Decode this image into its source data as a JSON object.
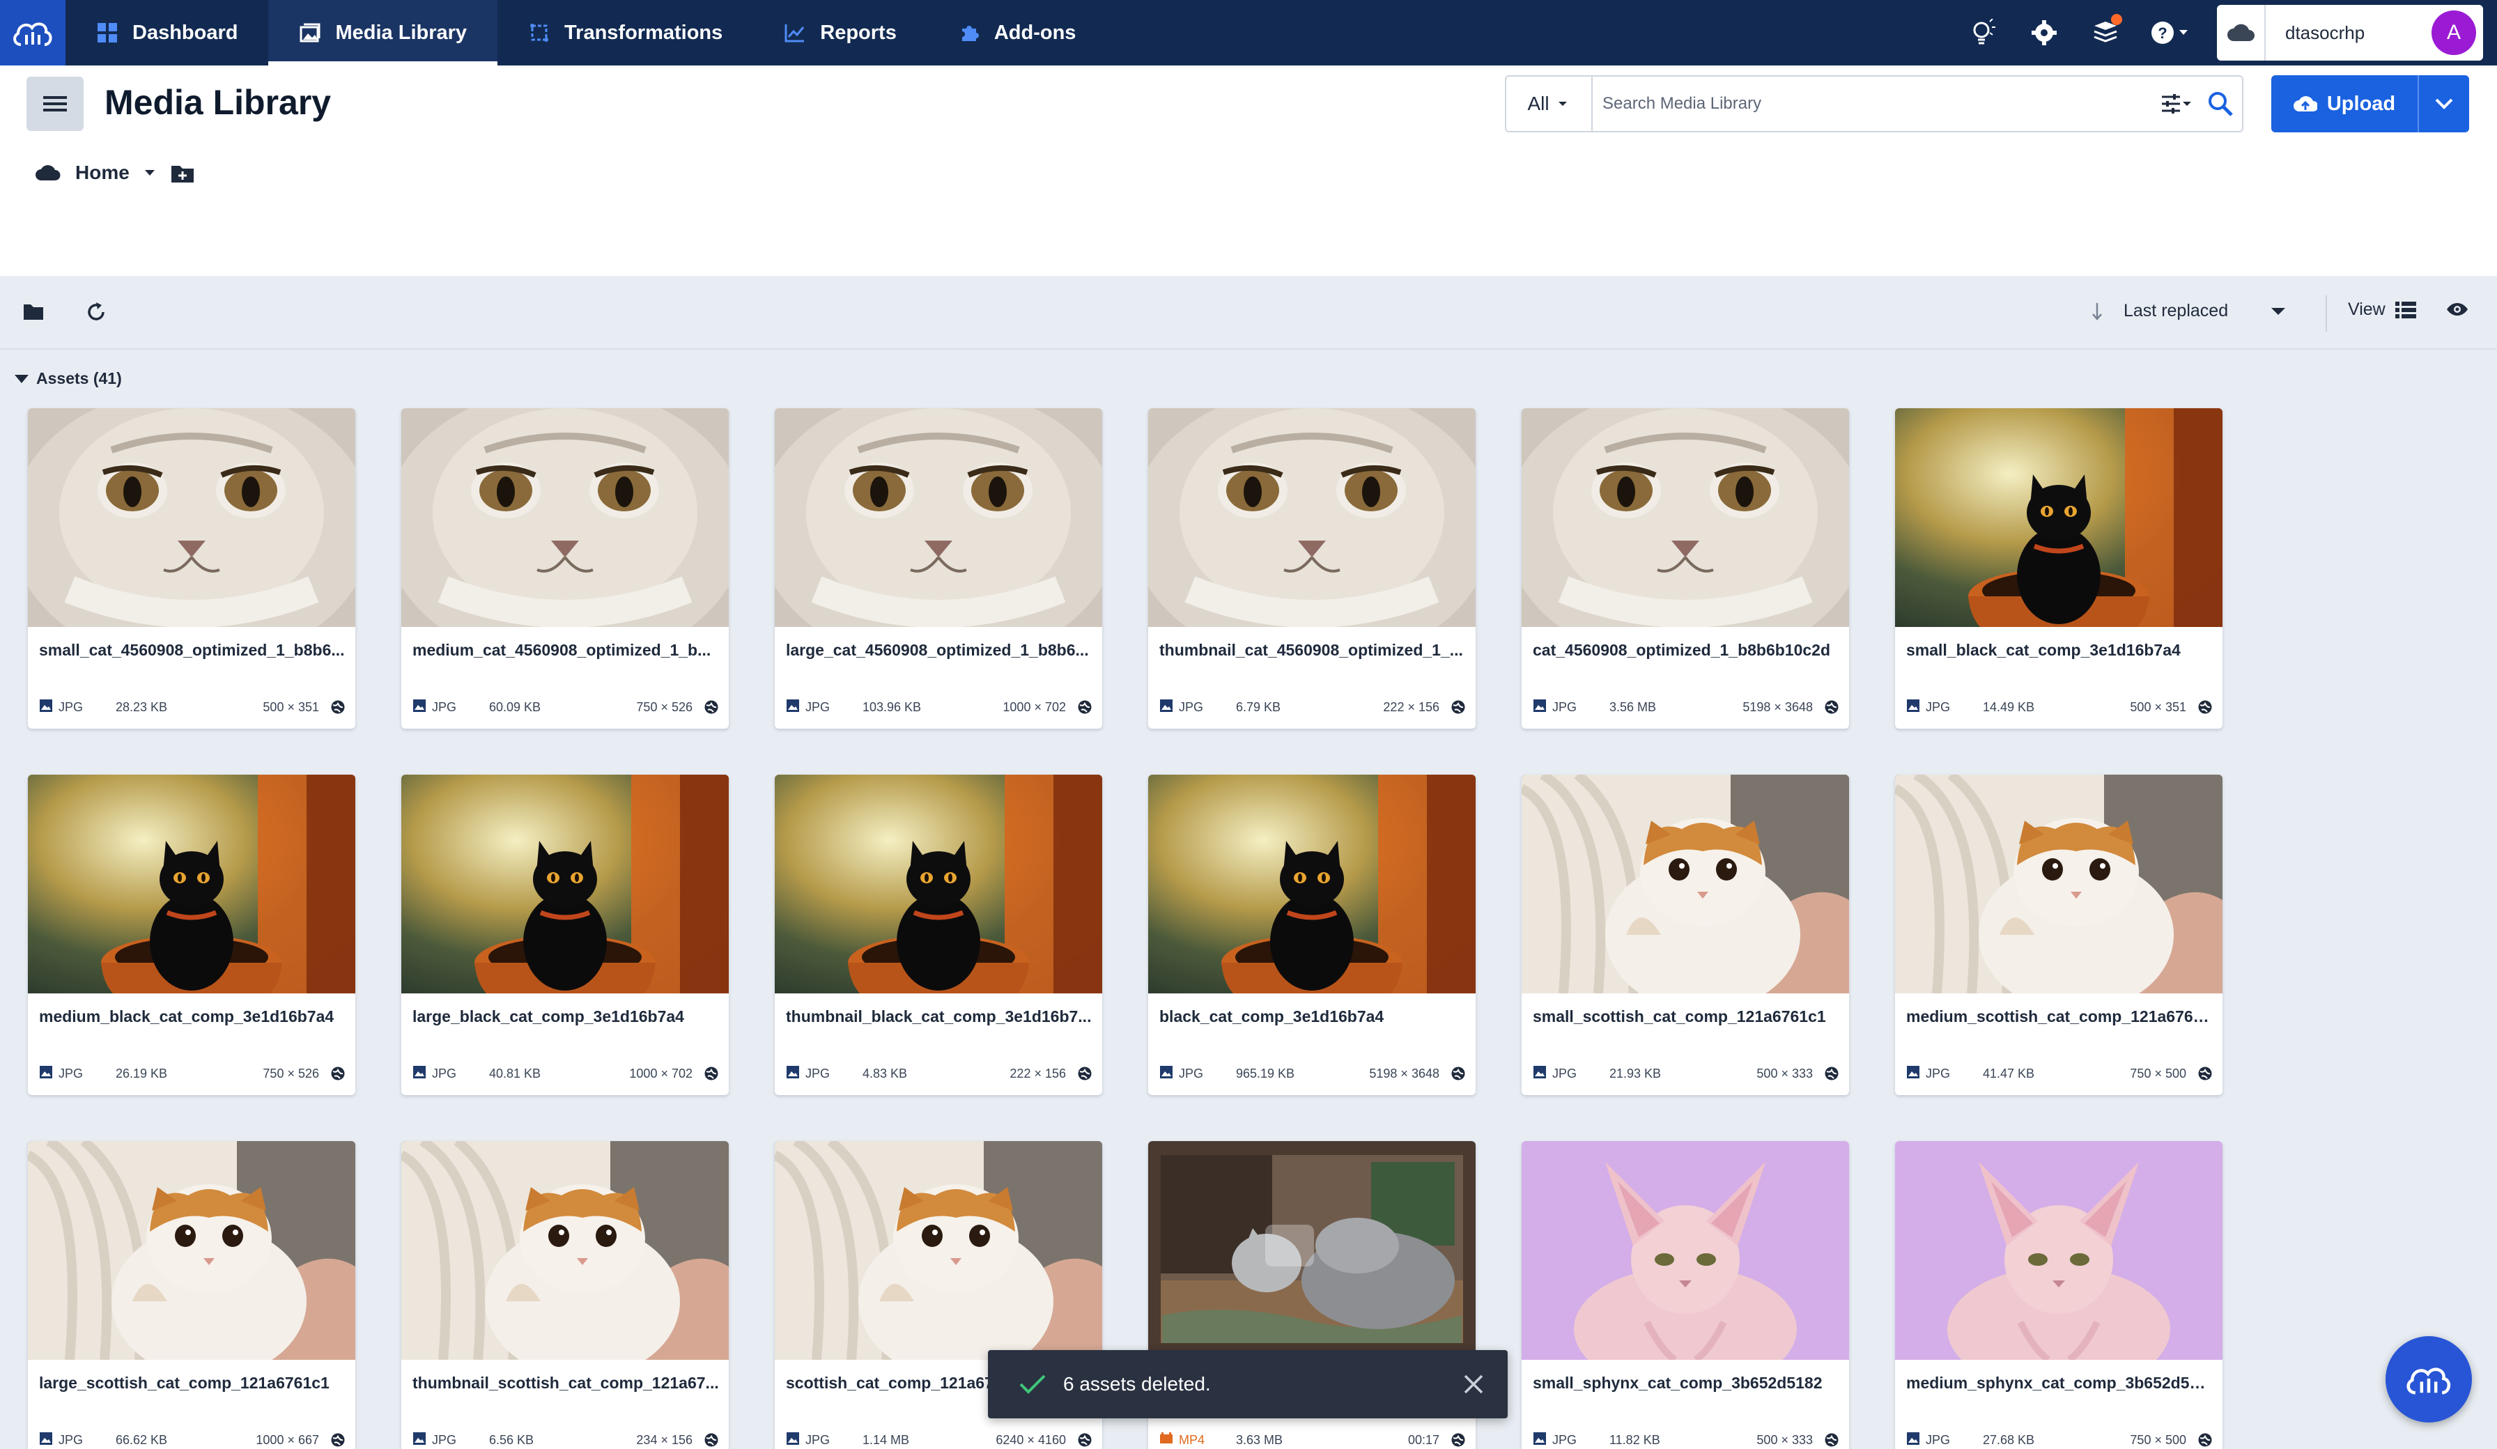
{
  "nav": {
    "items": [
      {
        "label": "Dashboard",
        "icon": "dashboard-icon"
      },
      {
        "label": "Media Library",
        "icon": "media-library-icon",
        "active": true
      },
      {
        "label": "Transformations",
        "icon": "transformations-icon"
      },
      {
        "label": "Reports",
        "icon": "reports-icon"
      },
      {
        "label": "Add-ons",
        "icon": "addons-icon"
      }
    ],
    "right_icons": [
      "lightbulb-icon",
      "gear-icon",
      "notifications-icon",
      "help-icon"
    ],
    "account_name": "dtasocrhp",
    "avatar_initial": "A",
    "colors": {
      "nav_bg": "#122a52",
      "avatar": "#9b1bd4",
      "accent": "#1a62e0"
    }
  },
  "header": {
    "title": "Media Library",
    "search_scope": "All",
    "search_placeholder": "Search Media Library",
    "upload_label": "Upload",
    "breadcrumb_home": "Home"
  },
  "toolbar": {
    "sort_label": "Last replaced",
    "view_label": "View"
  },
  "assets": {
    "heading": "Assets (41)",
    "items": [
      {
        "name": "small_cat_4560908_optimized_1_b8b6...",
        "type": "JPG",
        "size": "28.23 KB",
        "dims": "500 × 351",
        "image": "persian"
      },
      {
        "name": "medium_cat_4560908_optimized_1_b...",
        "type": "JPG",
        "size": "60.09 KB",
        "dims": "750 × 526",
        "image": "persian"
      },
      {
        "name": "large_cat_4560908_optimized_1_b8b6...",
        "type": "JPG",
        "size": "103.96 KB",
        "dims": "1000 × 702",
        "image": "persian"
      },
      {
        "name": "thumbnail_cat_4560908_optimized_1_...",
        "type": "JPG",
        "size": "6.79 KB",
        "dims": "222 × 156",
        "image": "persian"
      },
      {
        "name": "cat_4560908_optimized_1_b8b6b10c2d",
        "type": "JPG",
        "size": "3.56 MB",
        "dims": "5198 × 3648",
        "image": "persian"
      },
      {
        "name": "small_black_cat_comp_3e1d16b7a4",
        "type": "JPG",
        "size": "14.49 KB",
        "dims": "500 × 351",
        "image": "black"
      },
      {
        "name": "medium_black_cat_comp_3e1d16b7a4",
        "type": "JPG",
        "size": "26.19 KB",
        "dims": "750 × 526",
        "image": "black"
      },
      {
        "name": "large_black_cat_comp_3e1d16b7a4",
        "type": "JPG",
        "size": "40.81 KB",
        "dims": "1000 × 702",
        "image": "black"
      },
      {
        "name": "thumbnail_black_cat_comp_3e1d16b7...",
        "type": "JPG",
        "size": "4.83 KB",
        "dims": "222 × 156",
        "image": "black"
      },
      {
        "name": "black_cat_comp_3e1d16b7a4",
        "type": "JPG",
        "size": "965.19 KB",
        "dims": "5198 × 3648",
        "image": "black"
      },
      {
        "name": "small_scottish_cat_comp_121a6761c1",
        "type": "JPG",
        "size": "21.93 KB",
        "dims": "500 × 333",
        "image": "scottish"
      },
      {
        "name": "medium_scottish_cat_comp_121a6761c1",
        "type": "JPG",
        "size": "41.47 KB",
        "dims": "750 × 500",
        "image": "scottish"
      },
      {
        "name": "large_scottish_cat_comp_121a6761c1",
        "type": "JPG",
        "size": "66.62 KB",
        "dims": "1000 × 667",
        "image": "scottish"
      },
      {
        "name": "thumbnail_scottish_cat_comp_121a67...",
        "type": "JPG",
        "size": "6.56 KB",
        "dims": "234 × 156",
        "image": "scottish"
      },
      {
        "name": "scottish_cat_comp_121a6761c1",
        "type": "JPG",
        "size": "1.14 MB",
        "dims": "6240 × 4160",
        "image": "scottish"
      },
      {
        "name": "",
        "type": "MP4",
        "size": "3.63 MB",
        "dims": "00:17",
        "image": "video"
      },
      {
        "name": "small_sphynx_cat_comp_3b652d5182",
        "type": "JPG",
        "size": "11.82 KB",
        "dims": "500 × 333",
        "image": "sphynx"
      },
      {
        "name": "medium_sphynx_cat_comp_3b652d5182",
        "type": "JPG",
        "size": "27.68 KB",
        "dims": "750 × 500",
        "image": "sphynx"
      }
    ]
  },
  "toast": {
    "message": "6 assets deleted."
  }
}
